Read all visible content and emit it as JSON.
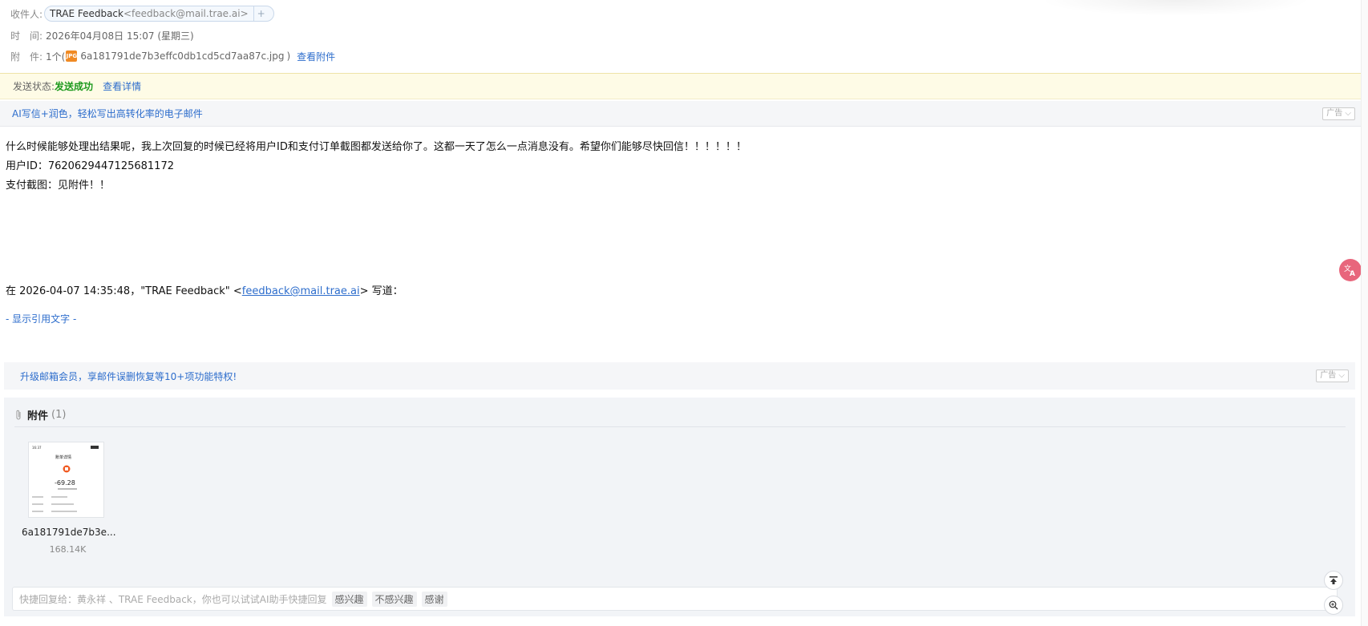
{
  "header": {
    "to_label": "收件人:",
    "recipient_name": "TRAE Feedback",
    "recipient_addr": "<feedback@mail.trae.ai>",
    "add_recipient": "+",
    "time_label": "时　间:",
    "time_value": "2026年04月08日 15:07 (星期三)",
    "attach_label": "附　件:",
    "attach_count": "1个(",
    "attach_icon_text": "JPG",
    "attach_filename": "6a181791de7b3effc0db1cd5cd7aa87c.jpg",
    "attach_close": ")",
    "view_attach": "查看附件"
  },
  "send_status": {
    "label": "发送状态:",
    "value": "发送成功",
    "details": "查看详情"
  },
  "ad_top": {
    "text": "AI写信+润色，轻松写出高转化率的电子邮件",
    "tag": "广告"
  },
  "body": {
    "line1": "什么时候能够处理出结果呢，我上次回复的时候已经将用户ID和支付订单截图都发送给你了。这都一天了怎么一点消息没有。希望你们能够尽快回信！！！！！！",
    "line2": "用户ID：7620629447125681172",
    "line3": "支付截图：见附件！！"
  },
  "quote": {
    "prefix": "在 2026-04-07 14:35:48，\"TRAE Feedback\" <",
    "email": "feedback@mail.trae.ai",
    "suffix": "> 写道：",
    "show_quote": "- 显示引用文字 -"
  },
  "ad_bottom": {
    "text": "升级邮箱会员，享邮件误删恢复等10+项功能特权!",
    "tag": "广告"
  },
  "attachments": {
    "title": "附件",
    "count": "(1)",
    "items": [
      {
        "name": "6a181791de7b3e...",
        "size": "168.14K",
        "thumb_amount": "-69.28",
        "thumb_title": "账单详情",
        "thumb_time": "16:37"
      }
    ]
  },
  "quick_reply": {
    "prompt": "快捷回复给：黄永祥 、TRAE Feedback，你也可以试试AI助手快捷回复",
    "chips": [
      "感兴趣",
      "不感兴趣",
      "感谢"
    ]
  },
  "colors": {
    "link": "#2d6dcc",
    "success": "#1e9a1e",
    "status_bg": "#fefbe6",
    "translate_btn": "#e8667c"
  }
}
